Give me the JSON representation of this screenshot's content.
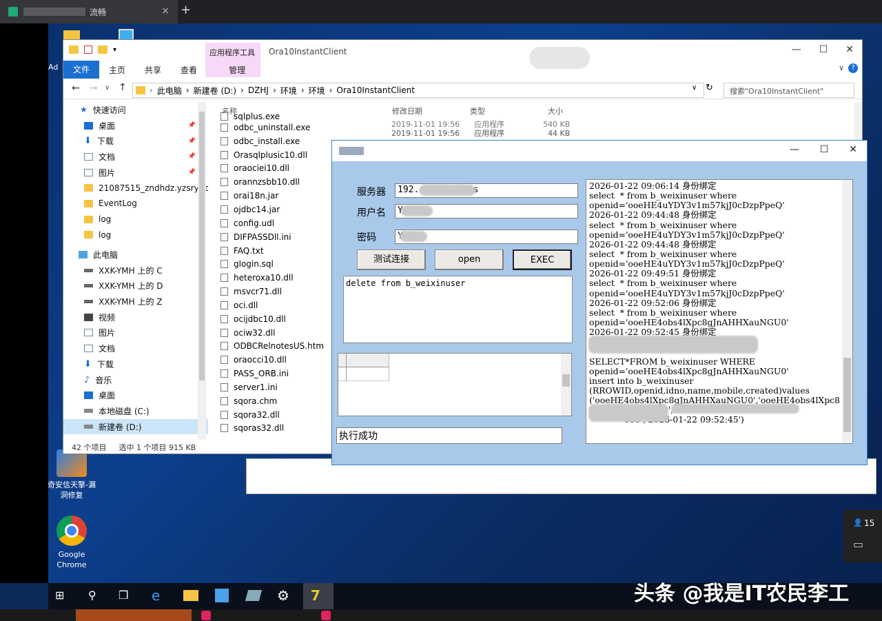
{
  "browser": {
    "tab_title": "流畅",
    "new_tab": "+",
    "close": "×"
  },
  "desktop": {
    "icons": [
      {
        "label": "Ad"
      },
      {
        "label": "奇安信天擎-漏洞修复"
      },
      {
        "label": "Google Chrome"
      }
    ]
  },
  "explorer": {
    "title": "Ora10InstantClient",
    "app_tools": "应用程序工具",
    "menu": {
      "file": "文件",
      "home": "主页",
      "share": "共享",
      "view": "查看",
      "manage": "管理"
    },
    "address": [
      "此电脑",
      "新建卷 (D:)",
      "DZHJ",
      "环境",
      "环境",
      "Ora10InstantClient"
    ],
    "search_placeholder": "搜索\"Ora10InstantClient\"",
    "nav": [
      "快速访问",
      "桌面",
      "下载",
      "文档",
      "图片",
      "21087515_zndhdz.yzsry.co",
      "EventLog",
      "log",
      "log",
      "此电脑",
      "XXK-YMH 上的 C",
      "XXK-YMH 上的 D",
      "XXK-YMH 上的 Z",
      "视频",
      "图片",
      "文档",
      "下载",
      "音乐",
      "桌面",
      "本地磁盘 (C:)",
      "新建卷 (D:)"
    ],
    "columns": {
      "name": "名称",
      "date": "修改日期",
      "type": "类型",
      "size": "大小"
    },
    "files": [
      {
        "name": "sqlplus.exe",
        "date": "2019-11-01 19:56",
        "type": "应用程序",
        "size": "540 KB"
      },
      {
        "name": "odbc_uninstall.exe",
        "date": "2019-11-01 19:56",
        "type": "应用程序",
        "size": "44 KB"
      },
      {
        "name": "odbc_install.exe"
      },
      {
        "name": "Orasqlplusic10.dll"
      },
      {
        "name": "oraociei10.dll"
      },
      {
        "name": "orannzsbb10.dll"
      },
      {
        "name": "orai18n.jar"
      },
      {
        "name": "ojdbc14.jar"
      },
      {
        "name": "config.udl"
      },
      {
        "name": "DIFPASSDll.ini"
      },
      {
        "name": "FAQ.txt"
      },
      {
        "name": "glogin.sql"
      },
      {
        "name": "heteroxa10.dll"
      },
      {
        "name": "msvcr71.dll"
      },
      {
        "name": "oci.dll"
      },
      {
        "name": "ocijdbc10.dll"
      },
      {
        "name": "ociw32.dll"
      },
      {
        "name": "ODBCRelnotesUS.htm"
      },
      {
        "name": "oraocci10.dll"
      },
      {
        "name": "PASS_ORB.ini"
      },
      {
        "name": "server1.ini"
      },
      {
        "name": "sqora.chm"
      },
      {
        "name": "sqora32.dll"
      },
      {
        "name": "sqoras32.dll"
      }
    ],
    "status": {
      "count": "42 个项目",
      "selected": "选中 1 个项目  915 KB"
    }
  },
  "dialog": {
    "server_label": "服务器",
    "server_value": "192.          40/orclhis",
    "user_label": "用户名",
    "user_value": "Y       .",
    "password_label": "密码",
    "password_value": "Y      H",
    "test_button": "测试连接",
    "open_button": "open",
    "exec_button": "EXEC",
    "sql_text": "delete from b_weixinuser",
    "result_message": "执行成功",
    "log_lines": [
      "2026-01-22 09:06:14 身份绑定",
      "select  * from b_weixinuser where",
      "openid='ooeHE4uYDY3v1m57kjJ0cDzpPpeQ'",
      "2026-01-22 09:44:48 身份绑定",
      "select  * from b_weixinuser where",
      "openid='ooeHE4uYDY3v1m57kjJ0cDzpPpeQ'",
      "2026-01-22 09:44:48 身份绑定",
      "select  * from b_weixinuser where",
      "openid='ooeHE4uYDY3v1m57kjJ0cDzpPpeQ'",
      "2026-01-22 09:49:51 身份绑定",
      "select  * from b_weixinuser where",
      "openid='ooeHE4uYDY3v1m57kjJ0cDzpPpeQ'",
      "2026-01-22 09:52:06 身份绑定",
      "select  * from b_weixinuser where",
      "openid='ooeHE4obs4lXpc8gJnAHHXauNGU0'",
      "2026-01-22 09:52:45 身份绑定",
      "",
      "",
      "SELECT*FROM b_weixinuser WHERE",
      "openid='ooeHE4obs4lXpc8gJnAHHXauNGU0'",
      "insert into b_weixinuser",
      "(RROWID,openid,idno,name,mobile,created)values",
      "('ooeHE4obs4lXpc8gJnAHHXauNGU0','ooeHE4obs4lXpc8",
      "gJnAHHXauNGU0','",
      "             999','2026-01-22 09:52:45')"
    ]
  },
  "watermark": "头条 @我是IT农民李工",
  "side_panel": {
    "count": "15"
  }
}
